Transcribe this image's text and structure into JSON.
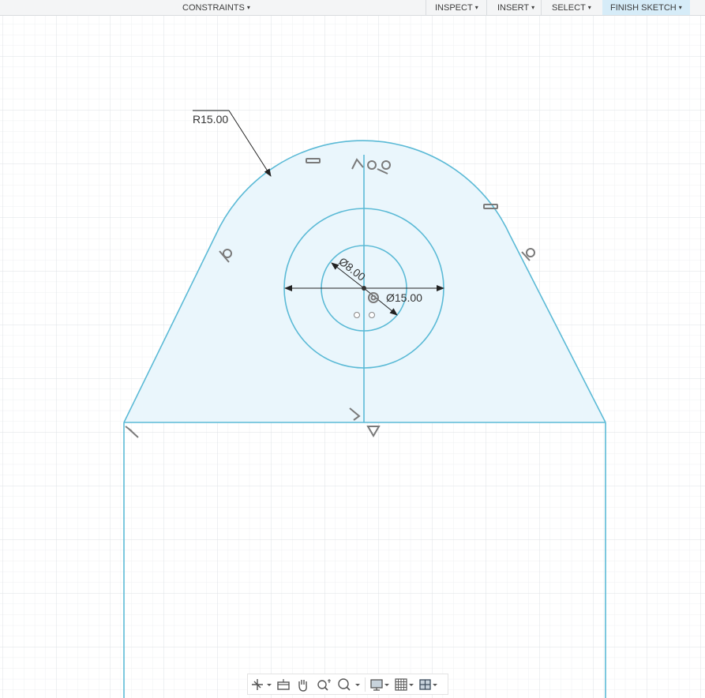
{
  "toolbar": {
    "constraints": "CONSTRAINTS",
    "inspect": "INSPECT",
    "insert": "INSERT",
    "select": "SELECT",
    "finish_sketch": "FINISH SKETCH",
    "caret": "▾"
  },
  "dimensions": {
    "radius": "R15.00",
    "inner_diameter": "Ø8.00",
    "outer_diameter": "Ø15.00"
  },
  "navbar": {
    "items": [
      "orbit-icon",
      "look-at-icon",
      "pan-icon",
      "zoom-icon",
      "fit-icon",
      "display-settings-icon",
      "grid-settings-icon",
      "viewports-icon"
    ]
  },
  "colors": {
    "sketch_line": "#5bbad6",
    "profile_fill": "#eaf6fc",
    "grid_minor": "#eef0f2",
    "grid_major": "#dde1e5",
    "finish_sketch_bg": "#d6ecf8"
  }
}
